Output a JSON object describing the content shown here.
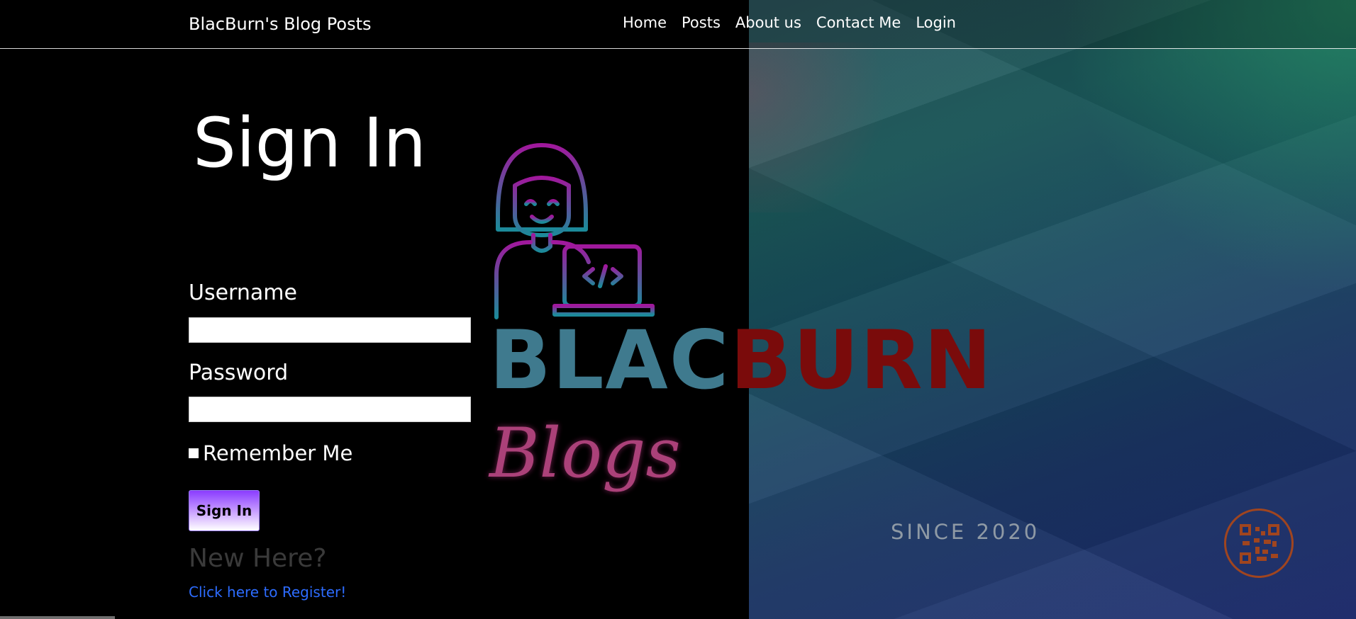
{
  "colors": {
    "accent_purple": "#8a3cff",
    "link_blue": "#2d6cff",
    "logo_blac": "#3f7a8e",
    "logo_burn": "#7a0b0b",
    "logo_script": "#c94d8f"
  },
  "navbar": {
    "brand": "BlacBurn's Blog Posts",
    "links": [
      {
        "label": "Home"
      },
      {
        "label": "Posts"
      },
      {
        "label": "About us"
      },
      {
        "label": "Contact Me"
      },
      {
        "label": "Login"
      }
    ]
  },
  "form": {
    "title": "Sign In",
    "username_label": "Username",
    "username_value": "",
    "password_label": "Password",
    "password_value": "",
    "remember_label": "Remember Me",
    "remember_checked": false,
    "submit_label": "Sign In",
    "new_here": "New Here?",
    "register_link": "Click here to Register!"
  },
  "logo": {
    "icon": "developer-with-laptop-icon",
    "word_part1": "BLAC",
    "word_part2": "BURN",
    "script": "Blogs",
    "since": "SINCE 2020",
    "qr_icon": "qr-code-icon"
  }
}
